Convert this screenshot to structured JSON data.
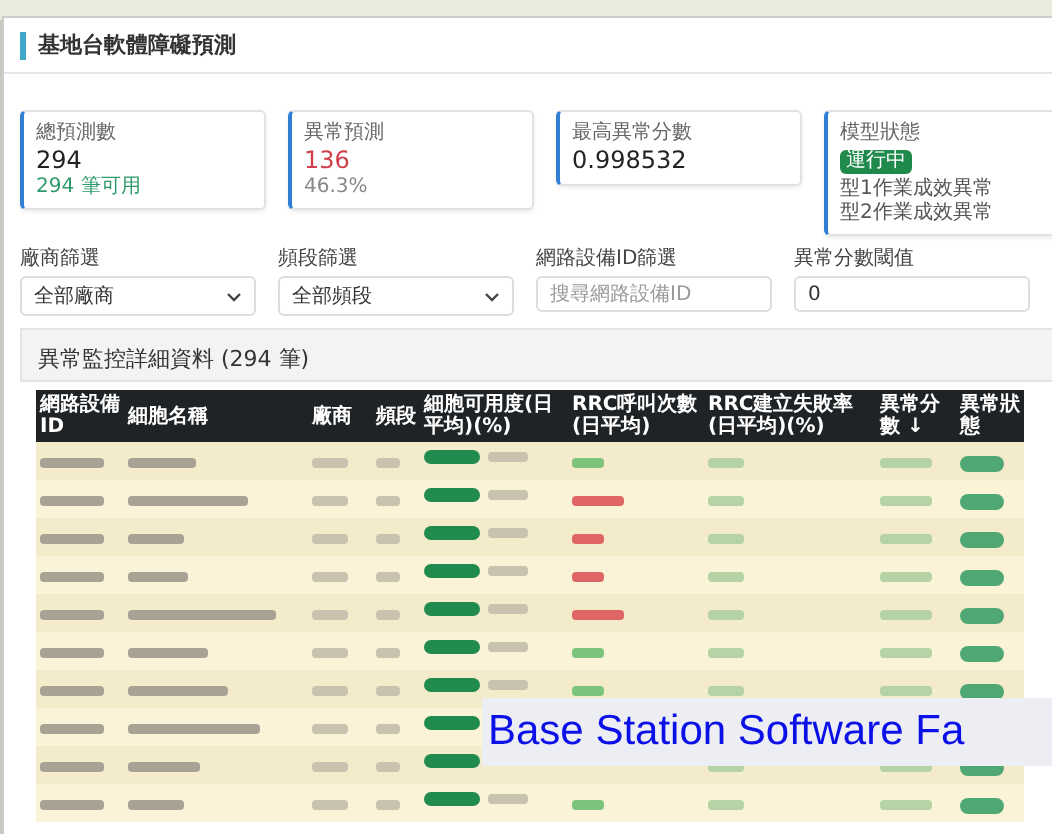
{
  "page": {
    "title": "基地台軟體障礙預測"
  },
  "stats": [
    {
      "kind": "value",
      "label": "總預測數",
      "value": "294",
      "sub": "294 筆可用",
      "alert": false
    },
    {
      "kind": "value",
      "label": "異常預測",
      "value": "136",
      "sub": "46.3%",
      "alert": true
    },
    {
      "kind": "value",
      "label": "最高異常分數",
      "value": "0.998532",
      "alert": false
    },
    {
      "kind": "status",
      "label": "模型狀態",
      "badge": "運行中",
      "lines": [
        "型1作業成效異常",
        "型2作業成效異常"
      ]
    }
  ],
  "filters": [
    {
      "kind": "select",
      "label": "廠商篩選",
      "value": "全部廠商"
    },
    {
      "kind": "select",
      "label": "頻段篩選",
      "value": "全部頻段"
    },
    {
      "kind": "input",
      "label": "網路設備ID篩選",
      "placeholder": "搜尋網路設備ID"
    },
    {
      "kind": "input",
      "label": "異常分數閾值",
      "value": "0"
    }
  ],
  "table": {
    "title": "異常監控詳細資料 (294 筆)",
    "columns": [
      "網路設備ID",
      "細胞名稱",
      "廠商",
      "頻段",
      "細胞可用度(日平均)(%)",
      "RRC呼叫次數(日平均)",
      "RRC建立失敗率(日平均)(%)",
      "異常分數 ↓",
      "異常狀態"
    ],
    "rows": [
      {
        "kind": "full",
        "color": "#7cc47c"
      },
      {
        "kind": "full",
        "color": "#e06666"
      },
      {
        "kind": "full",
        "color": "#e06666"
      },
      {
        "kind": "full",
        "color": "#e06666"
      },
      {
        "kind": "full",
        "color": "#e06666"
      },
      {
        "kind": "full",
        "color": "#7cc47c"
      },
      {
        "kind": "full",
        "color": "#7cc47c"
      },
      {
        "kind": "left"
      },
      {
        "kind": "partial"
      },
      {
        "kind": "full",
        "color": "#7cc47c"
      }
    ]
  },
  "caption": "Base Station Software Fa"
}
